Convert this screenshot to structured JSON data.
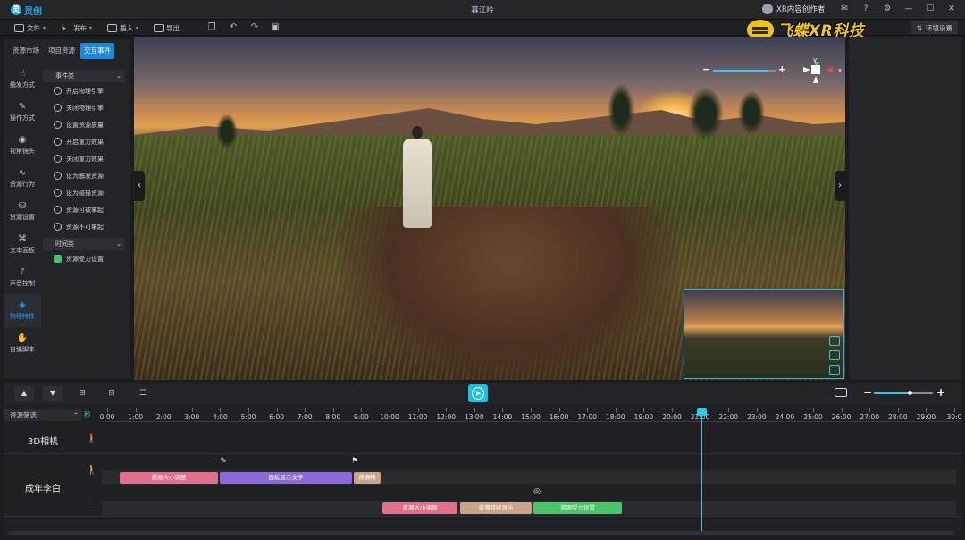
{
  "app": {
    "name": "灵创",
    "doc_title": "暮江吟"
  },
  "header": {
    "creator": "XR内容创作者",
    "watermark": "飞蝶XR科技"
  },
  "toolbar": {
    "file": "文件",
    "publish": "发布",
    "insert": "插入",
    "export": "导出",
    "env_settings": "环境设置"
  },
  "left_panel": {
    "tabs": [
      {
        "label": "资源市场",
        "active": false
      },
      {
        "label": "项目资源",
        "active": false
      },
      {
        "label": "交互事件",
        "active": true
      }
    ],
    "rail": [
      {
        "label": "触发方式",
        "icon": "hand-icon"
      },
      {
        "label": "操作方式",
        "icon": "wrench-icon"
      },
      {
        "label": "视角镜头",
        "icon": "camera-icon"
      },
      {
        "label": "资源行为",
        "icon": "behavior-icon"
      },
      {
        "label": "资源设置",
        "icon": "settings-icon"
      },
      {
        "label": "文本面板",
        "icon": "text-panel-icon"
      },
      {
        "label": "声音控制",
        "icon": "speaker-icon"
      },
      {
        "label": "物理特性",
        "icon": "physics-icon",
        "active": true
      },
      {
        "label": "自编脚本",
        "icon": "script-icon"
      }
    ],
    "event_category": "事件类",
    "events": [
      "开启物理引擎",
      "关闭物理引擎",
      "设置资源质量",
      "开启重力效果",
      "关闭重力效果",
      "设为触发资源",
      "设为碰撞资源",
      "资源可被拿起",
      "资源不可拿起"
    ],
    "time_category": "时间类",
    "time_events": [
      "资源受力设置"
    ]
  },
  "viewport": {
    "gizmo": {
      "y_label": "y",
      "x_label": "x"
    },
    "zoom_level": 0.88
  },
  "timeline": {
    "filter_label": "资源筛选",
    "seconds_label": "秒",
    "ticks": [
      "0:00",
      "1:00",
      "2:00",
      "3:00",
      "4:00",
      "5:00",
      "6:00",
      "7:00",
      "8:00",
      "9:00",
      "10:00",
      "11:00",
      "12:00",
      "13:00",
      "14:00",
      "15:00",
      "16:00",
      "17:00",
      "18:00",
      "19:00",
      "20:00",
      "21:00",
      "22:00",
      "23:00",
      "24:00",
      "25:00",
      "26:00",
      "27:00",
      "28:00",
      "29:00",
      "30:0"
    ],
    "zoom_level": 0.6,
    "playhead_time": "21:00",
    "tracks": [
      {
        "name": "3D相机"
      },
      {
        "name": "成年李白"
      }
    ],
    "clips_row1": [
      {
        "label": "资源大小调整",
        "color": "#e0708e"
      },
      {
        "label": "面板显示文字",
        "color": "#8a6ad8"
      },
      {
        "label": "资源特",
        "color": "#c8a48a"
      }
    ],
    "clips_row2": [
      {
        "label": "资源大小调整",
        "color": "#e0708e"
      },
      {
        "label": "资源特续显示",
        "color": "#c8a48a"
      },
      {
        "label": "资源受力设置",
        "color": "#4cc46a"
      }
    ]
  }
}
